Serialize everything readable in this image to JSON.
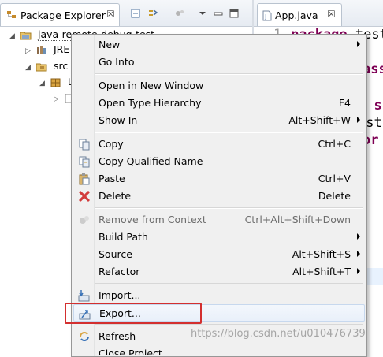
{
  "package_explorer": {
    "tab_label": "Package Explorer",
    "close_glyph": "☒"
  },
  "tree": {
    "project": "java-remote-debug-test",
    "jre": "JRE",
    "src": "src",
    "package_partial": "t"
  },
  "editor": {
    "tab_label": "App.java",
    "close_glyph": "☒",
    "line_number": "1",
    "line1_kw": "package",
    "line1_rest": " test",
    "line_class": "ass",
    "line_static": "c s",
    "line_system": "yst",
    "line_for": "or"
  },
  "menu": {
    "new": "New",
    "go_into": "Go Into",
    "open_new_window": "Open in New Window",
    "open_type_hierarchy": "Open Type Hierarchy",
    "open_type_hierarchy_sc": "F4",
    "show_in": "Show In",
    "show_in_sc": "Alt+Shift+W",
    "copy": "Copy",
    "copy_sc": "Ctrl+C",
    "copy_qualified": "Copy Qualified Name",
    "paste": "Paste",
    "paste_sc": "Ctrl+V",
    "delete": "Delete",
    "delete_sc": "Delete",
    "remove_context": "Remove from Context",
    "remove_context_sc": "Ctrl+Alt+Shift+Down",
    "build_path": "Build Path",
    "source": "Source",
    "source_sc": "Alt+Shift+S",
    "refactor": "Refactor",
    "refactor_sc": "Alt+Shift+T",
    "import": "Import...",
    "export": "Export...",
    "refresh": "Refresh",
    "next_partial": "Close Project"
  },
  "watermark": "https://blog.csdn.net/u010476739",
  "colors": {
    "keyword": "#7f0055",
    "highlight": "#d32f2f",
    "menu_bg": "#f0f0f0"
  }
}
